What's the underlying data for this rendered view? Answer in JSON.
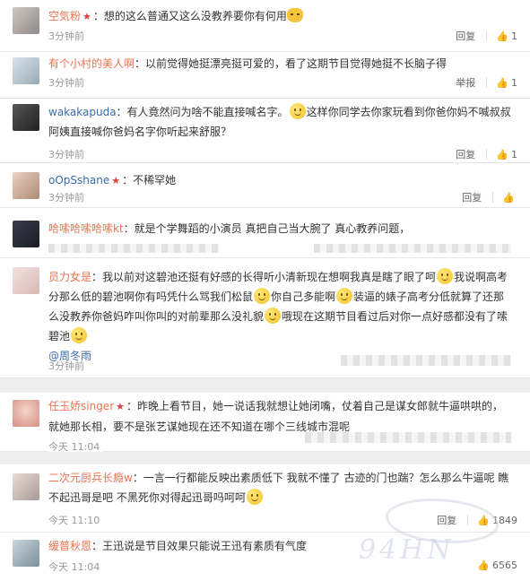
{
  "comments": [
    {
      "name": "空気粉",
      "has_star": true,
      "text": "：想的这么普通又这么没教养要你有何用",
      "time": "3分钟前",
      "reply": "回复",
      "likes": "1"
    },
    {
      "name": "有个小村的美人啊",
      "has_star": false,
      "text": "：以前觉得她挺漂亮挺可爱的，看了这期节目觉得她挺不长脑子得",
      "time": "3分钟前",
      "reply": "举报",
      "likes": "1"
    },
    {
      "name": "wakakapuda",
      "has_star": false,
      "text_a": "：有人竟然问为啥不能直接喊名字。",
      "text_b": "这样你同学去你家玩看到你爸你妈不喊叔叔阿姨直接喊你爸妈名字你听起来舒服？",
      "time": "3分钟前",
      "reply": "回复",
      "likes": "1"
    },
    {
      "name": "oOpSshane",
      "has_star": true,
      "text": "：不稀罕她",
      "time": "3分钟前",
      "reply": "回复",
      "likes": ""
    },
    {
      "name": "哈嗦哈嗦哈嗦kt",
      "has_star": false,
      "text": "：就是个学舞蹈的小演员 真把自己当大腕了 真心教养问题，",
      "time": "",
      "reply": "",
      "likes": ""
    },
    {
      "name": "员力女是",
      "has_star": false,
      "text_a": "：我以前对这碧池还挺有好感的长得听小清新现在想啊我真是瞎了眼了呵",
      "text_b": "我说啊高考分那么低的碧池啊你有吗凭什么骂我们松鼠",
      "text_c": "你自己多能啊",
      "text_d": "装逼的婊子高考分低就算了还那么没教养你爸妈咋叫你叫的对前辈那么没礼貌",
      "text_e": "哦现在这期节目看过后对你一点好感都没有了嗦碧池",
      "mention": "@周冬雨",
      "time": "3分钟前",
      "reply": "",
      "likes": ""
    },
    {
      "name": "任玉娇singer",
      "has_star": true,
      "text": "：昨晚上看节目，她一说话我就想让她闭嘴，仗着自己是谋女郎就牛逼哄哄的，就她那长相，要不是张艺谋她现在还不知道在哪个三线城市混呢",
      "time": "今天 11:04",
      "reply": "",
      "likes": ""
    },
    {
      "name": "二次元厨兵长瘾w",
      "has_star": false,
      "text_a": "：一言一行都能反映出素质低下 我就不懂了 古迹的门也踹？怎么那么牛逼呢 瞧不起迅哥是吧 不黑死你对得起迅哥吗呵呵",
      "time": "今天 11:10",
      "reply": "回复",
      "likes": "1849"
    },
    {
      "name": "缓普秋恩",
      "has_star": false,
      "text": "：王迅说是节目效果只能说王迅有素质有气度",
      "time": "今天 11:04",
      "reply": "",
      "likes": "6565"
    }
  ],
  "watermark": "94HN",
  "colors": {
    "name": "#eb7350",
    "mention": "#3b6aa6",
    "background": "#ffffff",
    "gap": "#efefef"
  },
  "icons": {
    "like": "thumb-up-icon",
    "star": "star-icon",
    "emoji": "smile-emoji-icon"
  }
}
